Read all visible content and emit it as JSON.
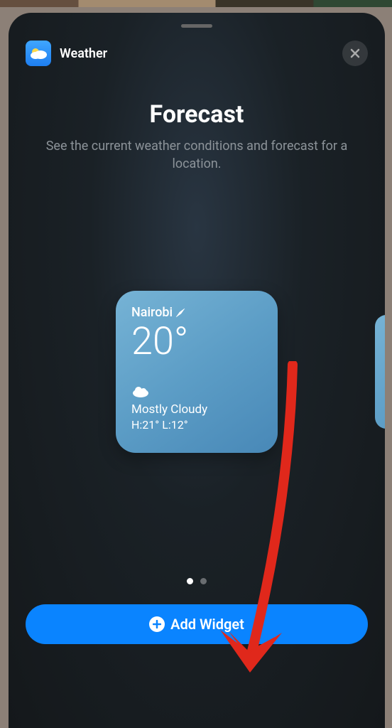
{
  "header": {
    "app_name": "Weather",
    "close_label": "Close"
  },
  "hero": {
    "title": "Forecast",
    "subtitle": "See the current weather conditions and forecast for a location."
  },
  "widget_preview": {
    "location": "Nairobi",
    "temperature": "20°",
    "condition": "Mostly Cloudy",
    "high": "21°",
    "low": "12°"
  },
  "action": {
    "add_label": "Add Widget"
  },
  "pagination": {
    "current": 1,
    "total": 2
  }
}
